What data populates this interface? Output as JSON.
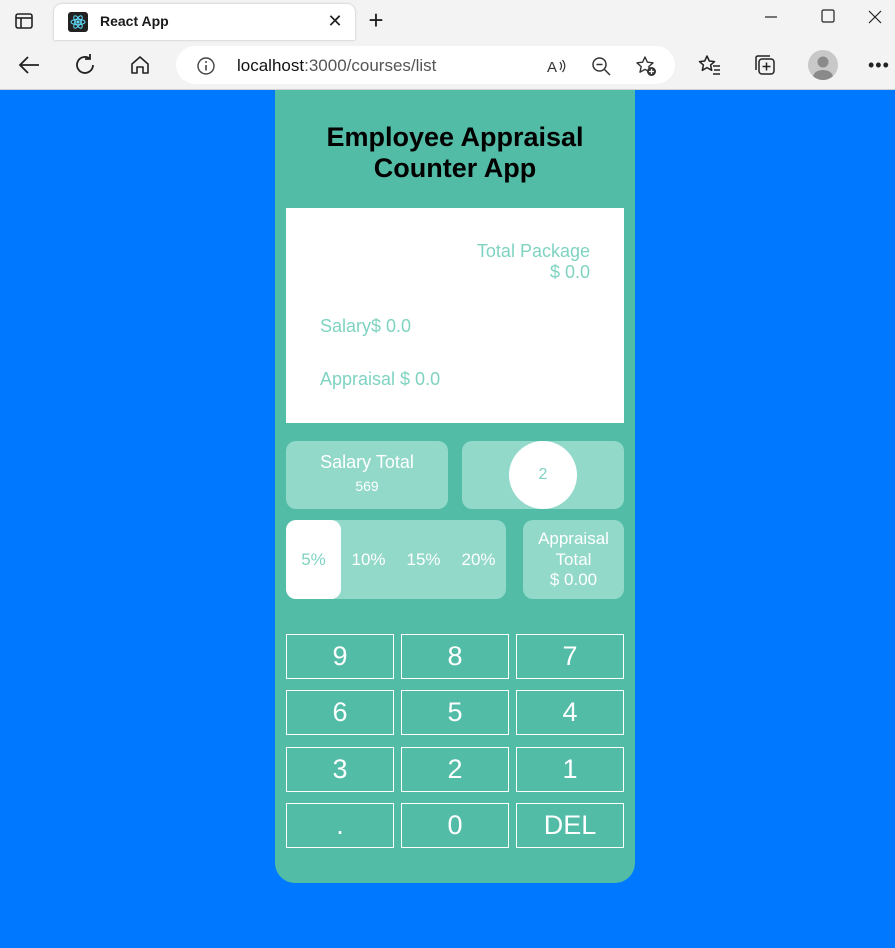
{
  "browser": {
    "tab_title": "React App",
    "url_host": "localhost",
    "url_path": ":3000/courses/list"
  },
  "app": {
    "title": "Employee Appraisal Counter App",
    "display": {
      "total_label": "Total Package",
      "total_value": "$ 0.0",
      "salary": "Salary$ 0.0",
      "appraisal": "Appraisal $ 0.0"
    },
    "salary_total": {
      "label": "Salary Total",
      "value": "569"
    },
    "counter": "2",
    "percent_options": [
      "5%",
      "10%",
      "15%",
      "20%"
    ],
    "selected_percent": "5%",
    "appraisal_total": {
      "label": "Appraisal Total",
      "value": "$ 0.00"
    },
    "keys": [
      [
        "9",
        "8",
        "7"
      ],
      [
        "6",
        "5",
        "4"
      ],
      [
        "3",
        "2",
        "1"
      ],
      [
        ".",
        "0",
        "DEL"
      ]
    ]
  },
  "colors": {
    "page_background": "#0078ff",
    "app_background": "#52bca7",
    "card_background": "#92d9ca",
    "accent_text": "#7fd3c2"
  }
}
